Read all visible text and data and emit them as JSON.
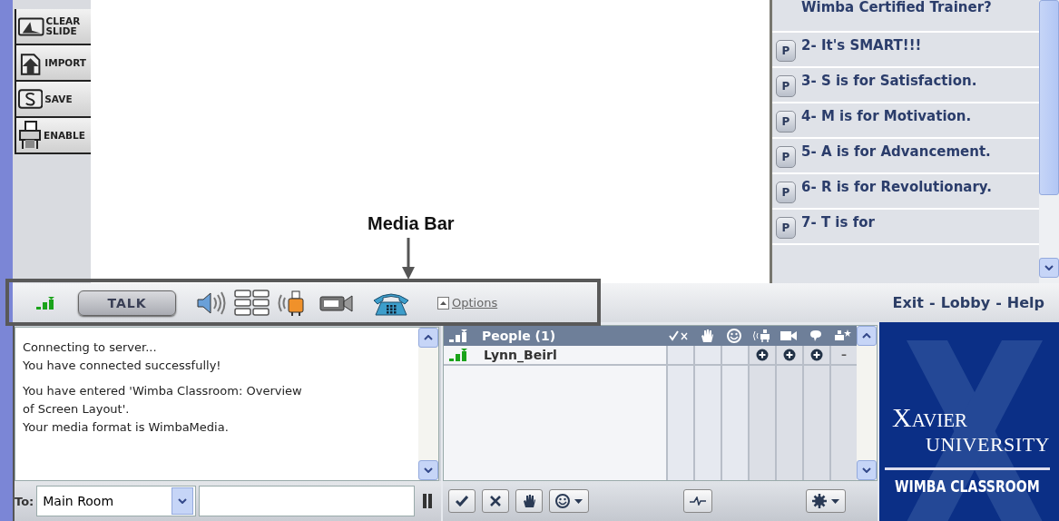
{
  "tools": [
    {
      "label": "CLEAR SLIDE",
      "kind": "clear"
    },
    {
      "label": "IMPORT",
      "kind": "import"
    },
    {
      "label": "SAVE",
      "kind": "save"
    },
    {
      "label": "ENABLE",
      "kind": "enable"
    }
  ],
  "slides": [
    {
      "title": "Wimba Certified Trainer?"
    },
    {
      "button": "P",
      "title": "2- It's SMART!!!"
    },
    {
      "button": "P",
      "title": "3- S is for Satisfaction."
    },
    {
      "button": "P",
      "title": "4- M is for Motivation."
    },
    {
      "button": "P",
      "title": "5- A is for Advancement."
    },
    {
      "button": "P",
      "title": "6- R is for Revolutionary."
    },
    {
      "button": "P",
      "title": "7- T is for"
    }
  ],
  "annotation": {
    "label": "Media Bar"
  },
  "media_bar": {
    "talk": "TALK",
    "options": "Options",
    "links": [
      "Exit",
      "Lobby",
      "Help"
    ],
    "separator": "-"
  },
  "chat": {
    "messages": [
      [
        "Connecting to server...",
        "You have connected successfully!"
      ],
      [
        "You have entered 'Wimba Classroom: Overview",
        "of Screen Layout'.",
        "Your media format is WimbaMedia."
      ]
    ],
    "to_label": "To:",
    "recipient": "Main Room"
  },
  "people": {
    "title": "People (1)",
    "rows": [
      {
        "name": "Lynn_Beirl",
        "cells": [
          {
            "kind": "empty"
          },
          {
            "kind": "empty"
          },
          {
            "kind": "empty"
          },
          {
            "kind": "plus"
          },
          {
            "kind": "plus"
          },
          {
            "kind": "plus"
          },
          {
            "kind": "text",
            "text": "–"
          }
        ]
      }
    ]
  },
  "logo": {
    "line1": "XAVIER",
    "line2": "UNIVERSITY",
    "line3": "WIMBA CLASSROOM"
  }
}
